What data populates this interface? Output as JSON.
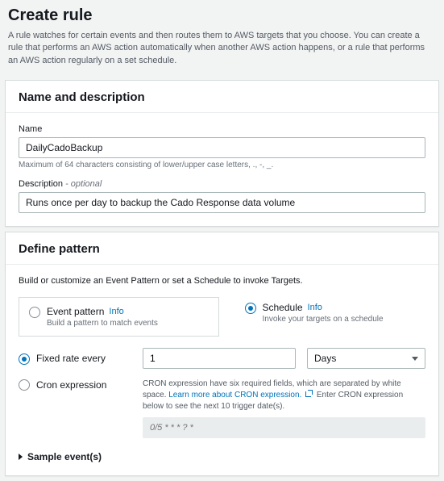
{
  "header": {
    "title": "Create rule",
    "description": "A rule watches for certain events and then routes them to AWS targets that you choose. You can create a rule that performs an AWS action automatically when another AWS action happens, or a rule that performs an AWS action regularly on a set schedule."
  },
  "nameDesc": {
    "sectionTitle": "Name and description",
    "nameLabel": "Name",
    "nameValue": "DailyCadoBackup",
    "nameHint": "Maximum of 64 characters consisting of lower/upper case letters, ., -, _.",
    "descLabel": "Description",
    "descOptional": " - optional",
    "descValue": "Runs once per day to backup the Cado Response data volume"
  },
  "pattern": {
    "sectionTitle": "Define pattern",
    "intro": "Build or customize an Event Pattern or set a Schedule to invoke Targets.",
    "eventPattern": {
      "label": "Event pattern",
      "info": "Info",
      "sub": "Build a pattern to match events"
    },
    "schedule": {
      "label": "Schedule",
      "info": "Info",
      "sub": "Invoke your targets on a schedule"
    },
    "fixedRate": {
      "label": "Fixed rate every",
      "value": "1",
      "unit": "Days"
    },
    "cron": {
      "label": "Cron expression",
      "desc1": "CRON expression have six required fields, which are separated by white space. ",
      "learnMore": "Learn more about CRON expression.",
      "desc2": " Enter CRON expression below to see the next 10 trigger date(s).",
      "placeholder": "0/5 * * * ? *"
    },
    "sample": "Sample event(s)"
  }
}
